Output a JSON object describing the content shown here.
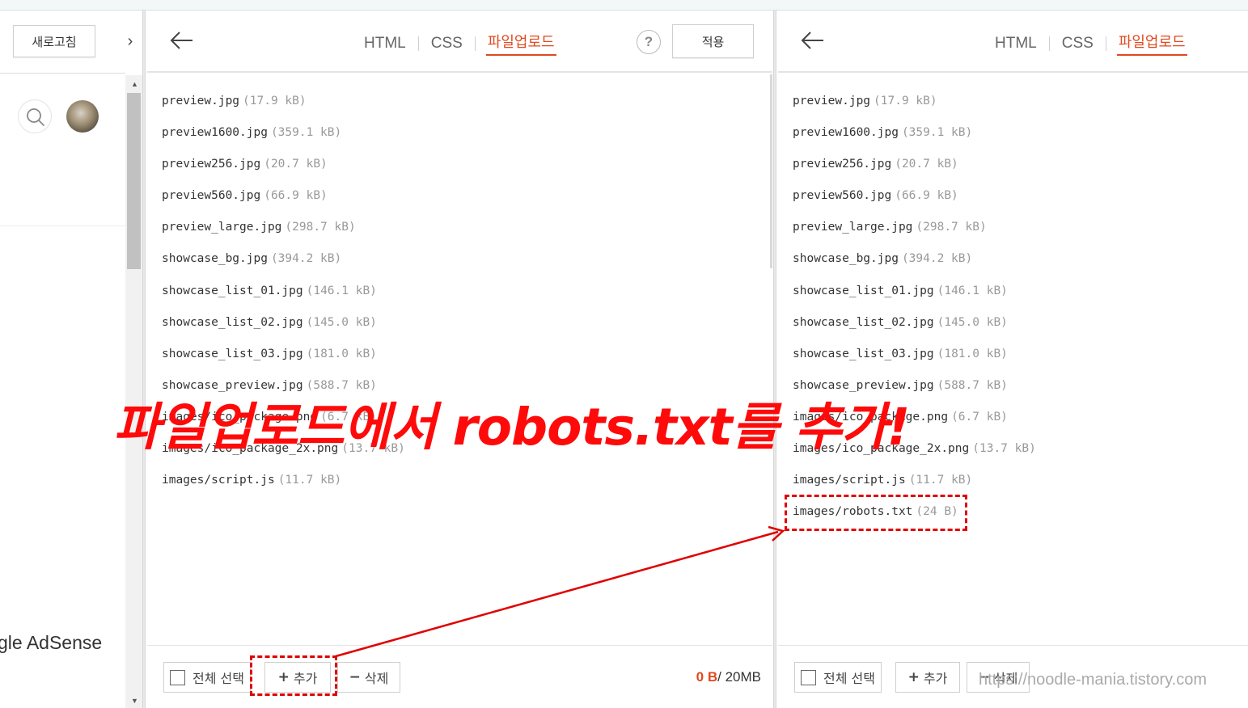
{
  "sidebar": {
    "refresh_label": "새로고침",
    "adsense_text": "gle AdSense"
  },
  "panel_left": {
    "tabs": [
      "HTML",
      "CSS",
      "파일업로드"
    ],
    "help_label": "?",
    "apply_label": "적용",
    "files": [
      {
        "name": "preview.jpg",
        "size": "(17.9 kB)"
      },
      {
        "name": "preview1600.jpg",
        "size": "(359.1 kB)"
      },
      {
        "name": "preview256.jpg",
        "size": "(20.7 kB)"
      },
      {
        "name": "preview560.jpg",
        "size": "(66.9 kB)"
      },
      {
        "name": "preview_large.jpg",
        "size": "(298.7 kB)"
      },
      {
        "name": "showcase_bg.jpg",
        "size": "(394.2 kB)"
      },
      {
        "name": "showcase_list_01.jpg",
        "size": "(146.1 kB)"
      },
      {
        "name": "showcase_list_02.jpg",
        "size": "(145.0 kB)"
      },
      {
        "name": "showcase_list_03.jpg",
        "size": "(181.0 kB)"
      },
      {
        "name": "showcase_preview.jpg",
        "size": "(588.7 kB)"
      },
      {
        "name": "images/ico_package.png",
        "size": "(6.7 kB)"
      },
      {
        "name": "images/ico_package_2x.png",
        "size": "(13.7 kB)"
      },
      {
        "name": "images/script.js",
        "size": "(11.7 kB)"
      }
    ],
    "footer": {
      "select_all": "전체 선택",
      "add_glyph": "+",
      "add_label": "추가",
      "delete_glyph": "−",
      "delete_label": "삭제",
      "quota_used": "0 B",
      "quota_total": "/ 20MB"
    }
  },
  "panel_right": {
    "tabs": [
      "HTML",
      "CSS",
      "파일업로드"
    ],
    "files": [
      {
        "name": "preview.jpg",
        "size": "(17.9 kB)"
      },
      {
        "name": "preview1600.jpg",
        "size": "(359.1 kB)"
      },
      {
        "name": "preview256.jpg",
        "size": "(20.7 kB)"
      },
      {
        "name": "preview560.jpg",
        "size": "(66.9 kB)"
      },
      {
        "name": "preview_large.jpg",
        "size": "(298.7 kB)"
      },
      {
        "name": "showcase_bg.jpg",
        "size": "(394.2 kB)"
      },
      {
        "name": "showcase_list_01.jpg",
        "size": "(146.1 kB)"
      },
      {
        "name": "showcase_list_02.jpg",
        "size": "(145.0 kB)"
      },
      {
        "name": "showcase_list_03.jpg",
        "size": "(181.0 kB)"
      },
      {
        "name": "showcase_preview.jpg",
        "size": "(588.7 kB)"
      },
      {
        "name": "images/ico_package.png",
        "size": "(6.7 kB)"
      },
      {
        "name": "images/ico_package_2x.png",
        "size": "(13.7 kB)"
      },
      {
        "name": "images/script.js",
        "size": "(11.7 kB)"
      },
      {
        "name": "images/robots.txt",
        "size": "(24 B)"
      }
    ],
    "footer": {
      "select_all": "전체 선택",
      "add_glyph": "+",
      "add_label": "추가",
      "delete_glyph": "−",
      "delete_label": "삭제"
    }
  },
  "annotation": {
    "caption": "파일업로드에서 robots.txt를 추가!",
    "watermark": "https://noodle-mania.tistory.com",
    "color": "#ff0a0a"
  },
  "colors": {
    "accent": "#e04a1f",
    "annotation": "#e00000"
  },
  "icons": [
    "back-arrow-icon",
    "chevron-right-icon",
    "search-icon",
    "help-icon",
    "checkbox-icon"
  ]
}
